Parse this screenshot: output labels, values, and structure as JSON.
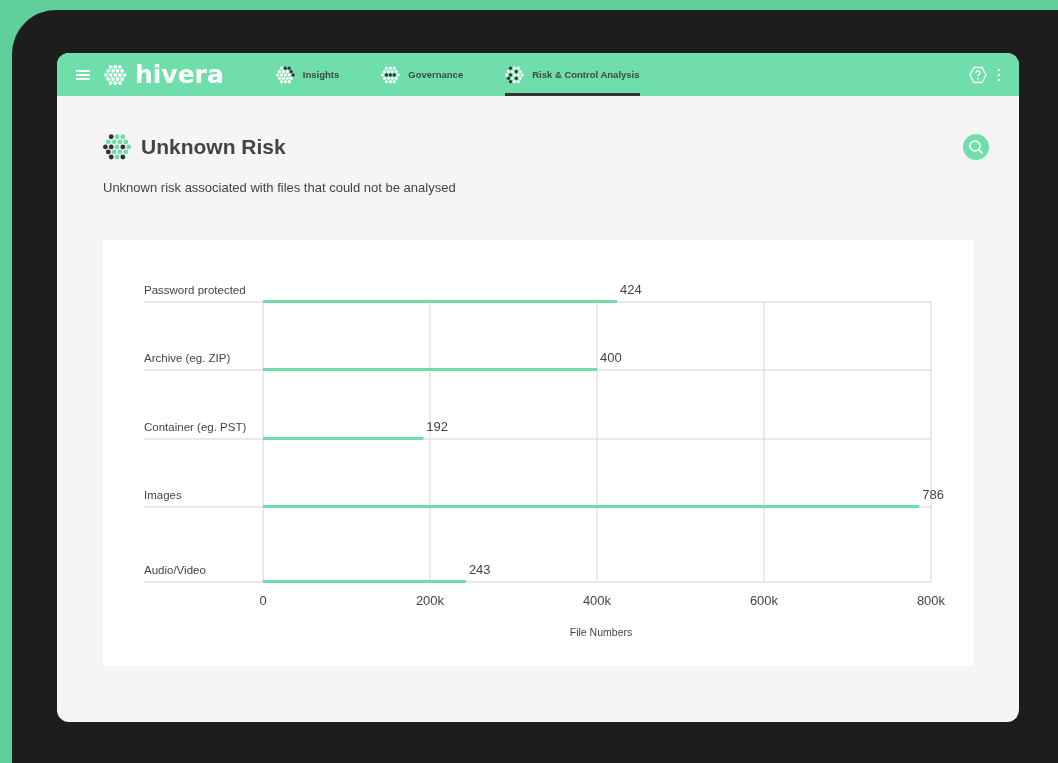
{
  "app": {
    "logo": "hivera"
  },
  "nav_tabs": [
    {
      "label": "Insights",
      "selected": false
    },
    {
      "label": "Governance",
      "selected": false
    },
    {
      "label": "Risk & Control Analysis",
      "selected": true
    }
  ],
  "page": {
    "title": "Unknown Risk",
    "subtitle": "Unknown risk associated with files that could not be analysed"
  },
  "chart_data": {
    "type": "bar",
    "orientation": "horizontal",
    "xlabel": "File Numbers",
    "categories": [
      "Password protected",
      "Archive (eg. ZIP)",
      "Container (eg. PST)",
      "Images",
      "Audio/Video"
    ],
    "series": [
      {
        "color": "#6fdcaa",
        "values": [
          424000,
          400000,
          192000,
          786000,
          243000
        ]
      }
    ],
    "grid": true,
    "value_labels": [
      "424",
      "400",
      "192",
      "786",
      "243"
    ],
    "xlim": [
      0,
      800000
    ],
    "xticks": [
      {
        "value": 0,
        "label": "0"
      },
      {
        "value": 200000,
        "label": "200k"
      },
      {
        "value": 400000,
        "label": "400k"
      },
      {
        "value": 600000,
        "label": "600k"
      },
      {
        "value": 800000,
        "label": "800k"
      }
    ]
  }
}
